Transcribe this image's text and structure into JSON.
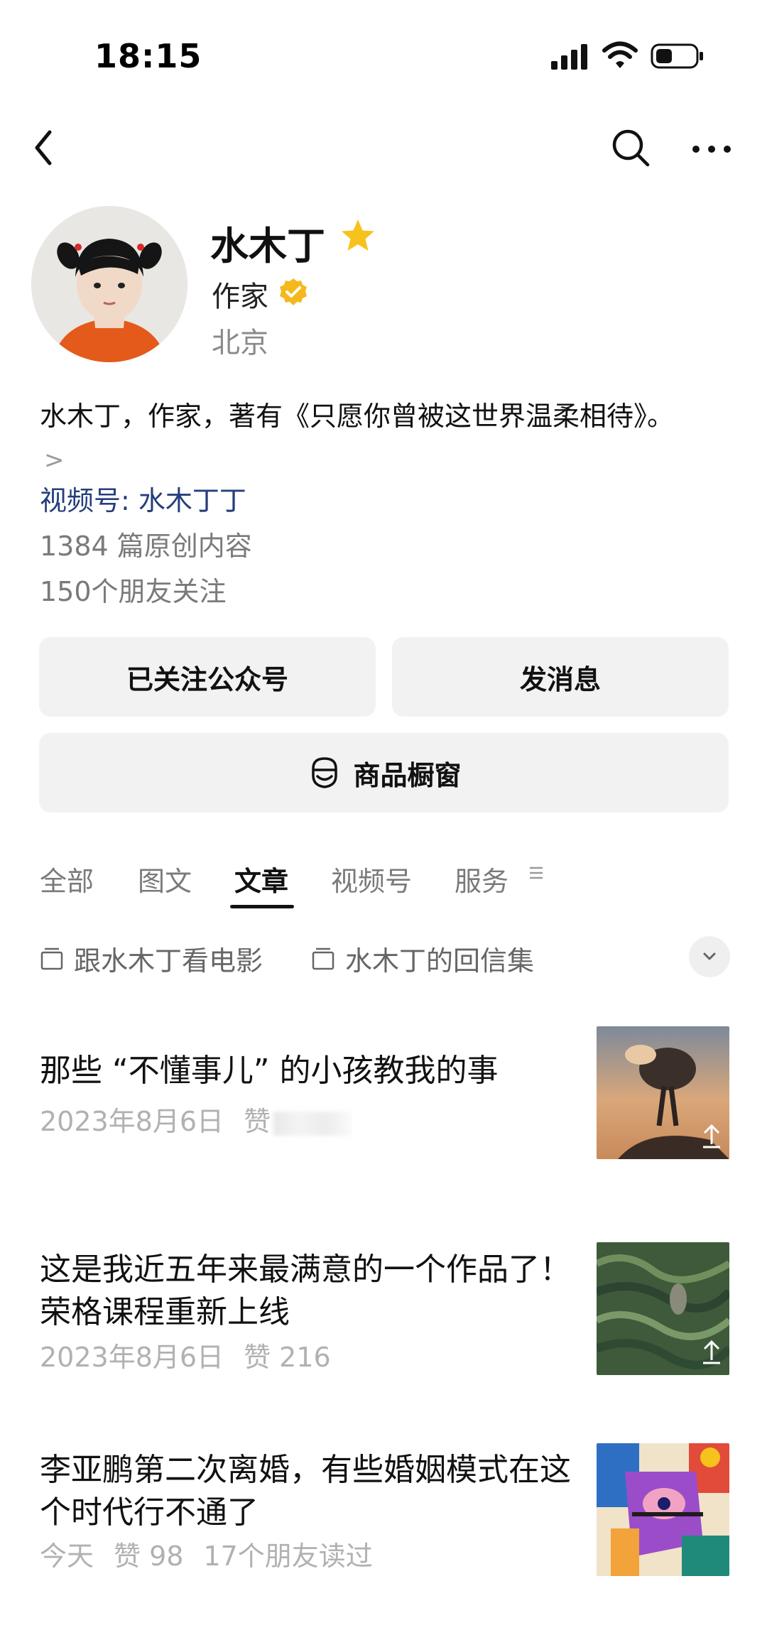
{
  "status_bar": {
    "time": "18:15"
  },
  "profile": {
    "name": "水木丁",
    "role": "作家",
    "location": "北京",
    "bio": "水木丁，作家，著有《只愿你曾被这世界温柔相待》。",
    "bio_arrow": ">",
    "channel": "视频号: 水木丁丁",
    "original_count": "1384 篇原创内容",
    "friends_following": "150个朋友关注"
  },
  "actions": {
    "follow_label": "已关注公众号",
    "message_label": "发消息",
    "shop_label": "商品橱窗"
  },
  "tabs": [
    {
      "label": "全部"
    },
    {
      "label": "图文"
    },
    {
      "label": "文章",
      "active": true
    },
    {
      "label": "视频号"
    },
    {
      "label": "服务"
    }
  ],
  "collections": [
    {
      "label": "跟水木丁看电影"
    },
    {
      "label": "水木丁的回信集"
    }
  ],
  "articles": [
    {
      "title": "那些 “不懂事儿” 的小孩教我的事",
      "date": "2023年8月6日",
      "likes": "赞"
    },
    {
      "title": "这是我近五年来最满意的一个作品了！荣格课程重新上线",
      "date": "2023年8月6日",
      "likes": "赞 216"
    },
    {
      "title": "李亚鹏第二次离婚，有些婚姻模式在这个时代行不通了",
      "date": "今天",
      "likes": "赞 98",
      "friends_read": "17个朋友读过"
    }
  ],
  "colors": {
    "accent_star": "#f6c21c",
    "verified": "#f5b81c",
    "channel_link": "#253f7c",
    "tab_active": "#111111"
  },
  "icons": [
    "back-icon",
    "search-icon",
    "more-icon",
    "star-icon",
    "verified-icon",
    "shop-window-icon",
    "tab-menu-icon",
    "collection-icon",
    "chevron-down-icon",
    "share-icon"
  ]
}
